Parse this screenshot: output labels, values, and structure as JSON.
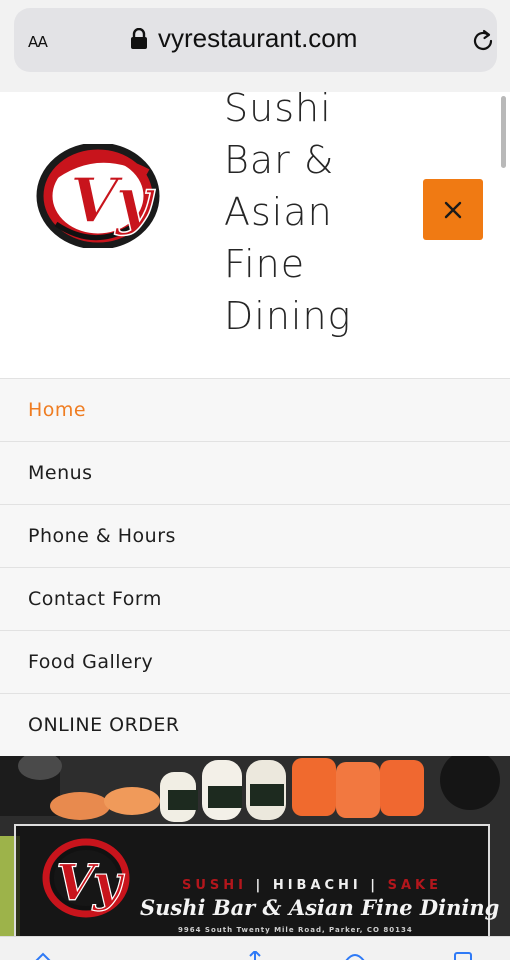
{
  "browser": {
    "reader_label": "AA",
    "url": "vyrestaurant.com"
  },
  "header": {
    "logo_text": "Vy",
    "title_lines": [
      "Sushi",
      "Bar &",
      "Asian",
      "Fine",
      "Dining"
    ]
  },
  "nav": {
    "items": [
      {
        "label": "Home",
        "active": true
      },
      {
        "label": "Menus",
        "active": false
      },
      {
        "label": "Phone & Hours",
        "active": false
      },
      {
        "label": "Contact Form",
        "active": false
      },
      {
        "label": "Food Gallery",
        "active": false
      },
      {
        "label": "ONLINE ORDER",
        "active": false
      }
    ]
  },
  "banner": {
    "logo_text": "Vy",
    "tagline": [
      "SUSHI",
      "HIBACHI",
      "SAKE"
    ],
    "title": "Sushi Bar & Asian Fine Dining",
    "address": "9964 South Twenty Mile Road, Parker, CO 80134"
  },
  "colors": {
    "accent": "#f07a13",
    "active_nav": "#ef7d22",
    "brand_red": "#c8141c"
  },
  "icons": {
    "lock": "lock-icon",
    "reload": "reload-icon",
    "close": "close-icon"
  }
}
